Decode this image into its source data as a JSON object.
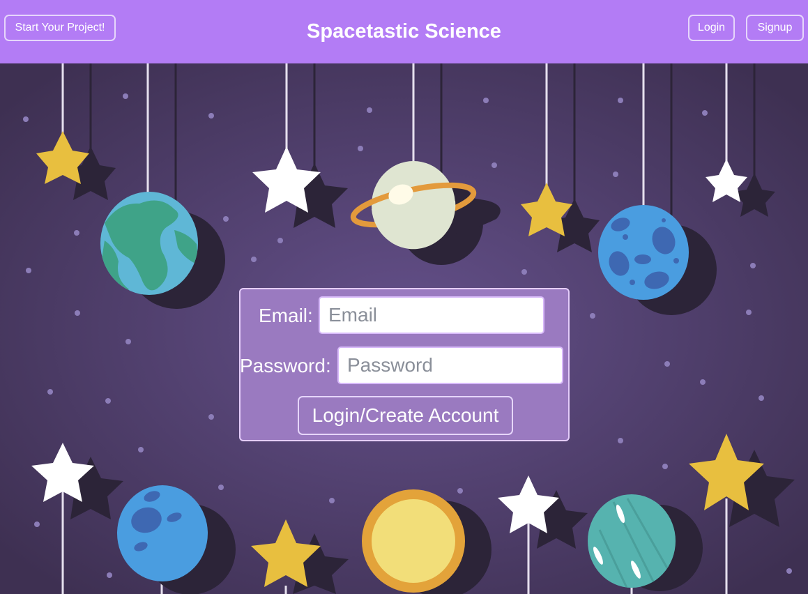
{
  "header": {
    "title": "Spacetastic Science",
    "start_button": "Start Your Project!",
    "login_button": "Login",
    "signup_button": "Signup"
  },
  "login_form": {
    "email_label": "Email:",
    "email_placeholder": "Email",
    "email_value": "",
    "password_label": "Password:",
    "password_placeholder": "Password",
    "password_value": "",
    "submit_label": "Login/Create Account"
  },
  "colors": {
    "navbar": "#b37cf5",
    "background": "#4a3a63",
    "card": "#9a7ac0",
    "star_yellow": "#e8bf3f",
    "planet_blue": "#4a9de0"
  }
}
